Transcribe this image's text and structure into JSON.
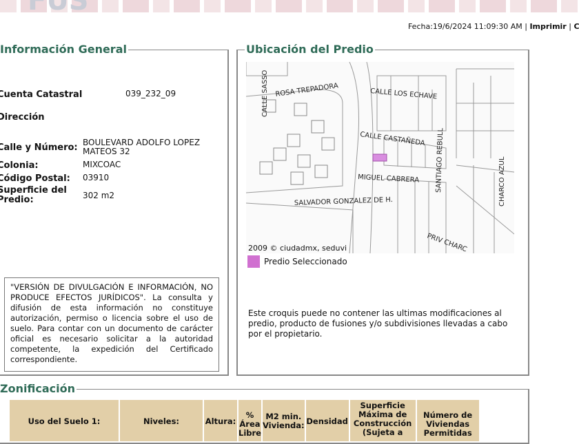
{
  "header": {
    "logo_text": "FUS",
    "fecha": "Fecha:19/6/2024 11:09:30 AM",
    "sep": "|",
    "imprimir": "Imprimir",
    "cerrar": "Ce"
  },
  "info": {
    "title": "Información General",
    "fields": [
      {
        "label": "Cuenta Catastral",
        "value": "039_232_09"
      },
      {
        "label": "Dirección",
        "value": ""
      },
      {
        "label": "Calle y Número:",
        "value": "BOULEVARD ADOLFO LOPEZ MATEOS 32"
      },
      {
        "label": "Colonia:",
        "value": "MIXCOAC"
      },
      {
        "label": "Código Postal:",
        "value": "03910"
      },
      {
        "label": "Superficie del Predio:",
        "value": "302 m2"
      }
    ],
    "notice": "\"VERSIÓN DE DIVULGACIÓN E INFORMACIÓN, NO PRODUCE EFECTOS JURÍDICOS\". La consulta y difusión de esta información no constituye autorización, permiso o licencia sobre el uso de suelo. Para contar con un documento de carácter oficial es necesario solicitar a la autoridad competente, la expedición del Certificado correspondiente."
  },
  "ubicacion": {
    "title": "Ubicación del Predio",
    "streets": [
      "CALLE SASSO",
      "ROSA TREPADORA",
      "CALLE LOS ECHAVE",
      "CALLE CASTAÑEDA",
      "MIGUEL CABRERA",
      "SALVADOR GONZALEZ DE H.",
      "SANTIAGO REBULL",
      "CHARCO AZUL",
      "PRIV CHARC"
    ],
    "copyright": "2009 © ciudadmx, seduvi",
    "legend": "Predio Seleccionado",
    "legend_color": "#d070d0",
    "note": "Este croquis puede no contener las ultimas modificaciones al predio, producto de fusiones y/o subdivisiones llevadas a cabo por el propietario."
  },
  "zonificacion": {
    "title": "Zonificación",
    "headers": [
      "Uso del Suelo 1:",
      "Niveles:",
      "Altura:",
      "% Área Libre",
      "M2 min. Vivienda:",
      "Densidad",
      "Superficie Máxima de Construcción (Sujeta a",
      "Número de Viviendas Permitidas"
    ]
  }
}
